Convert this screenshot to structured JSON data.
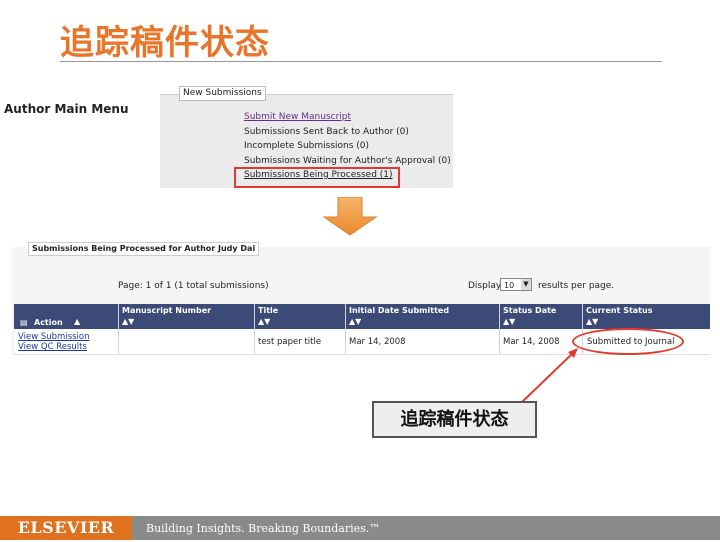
{
  "slide": {
    "title": "追踪稿件状态",
    "callout": "追踪稿件状态"
  },
  "author_menu": {
    "title": "Author Main Menu"
  },
  "new_submissions": {
    "header": "New Submissions",
    "items": [
      "Submit New Manuscript",
      "Submissions Sent Back to Author (0)",
      "Incomplete Submissions (0)",
      "Submissions Waiting for Author's Approval (0)",
      "Submissions Being Processed (1)"
    ]
  },
  "processing": {
    "header": "Submissions Being Processed for Author Judy Dai",
    "page_info": "Page: 1 of 1 (1 total submissions)",
    "display_label": "Display",
    "display_value": "10",
    "results_text": "results per page.",
    "columns": [
      "Action",
      "Manuscript Number",
      "Title",
      "Initial Date Submitted",
      "Status Date",
      "Current Status"
    ],
    "row": {
      "actions": [
        "View Submission",
        "View QC Results"
      ],
      "manuscript_number": "",
      "title": "test paper title",
      "initial_date": "Mar 14, 2008",
      "status_date": "Mar 14, 2008",
      "current_status": "Submitted to Journal"
    }
  },
  "footer": {
    "logo": "ELSEVIER",
    "tagline": "Building Insights. Breaking Boundaries.™"
  },
  "colors": {
    "title": "#e8752a",
    "highlight": "#e03a2e",
    "table_header": "#3c4a78",
    "footer_logo": "#e0711f"
  }
}
